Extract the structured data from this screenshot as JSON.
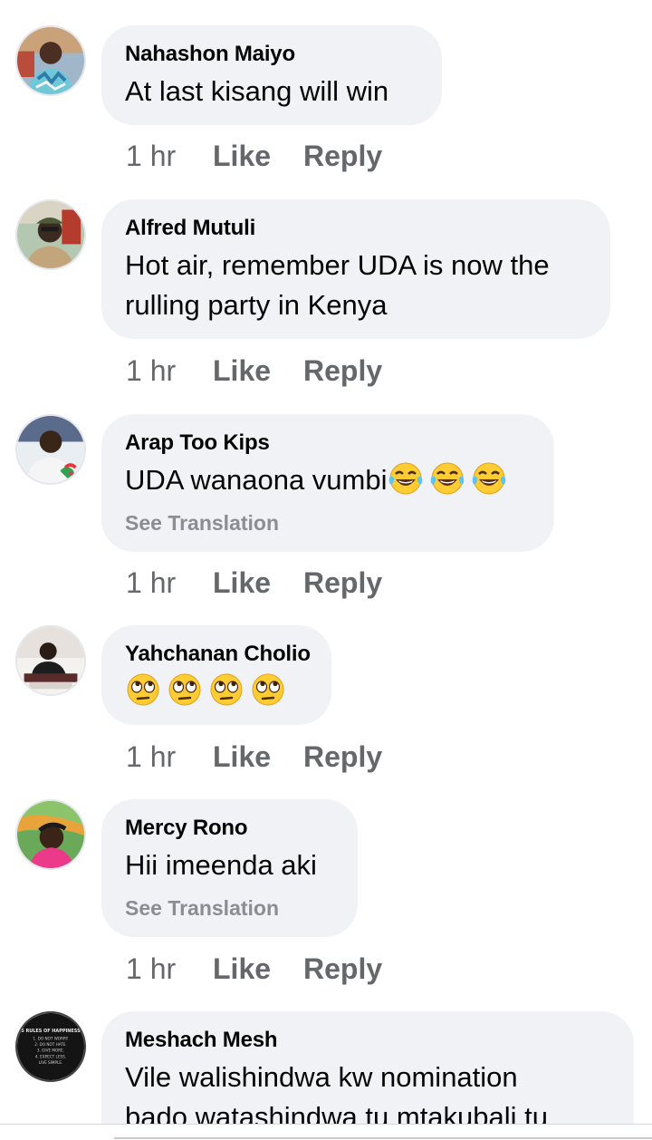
{
  "comments": [
    {
      "author": "Nahashon Maiyo",
      "text": "At last kisang will win",
      "time": "1 hr",
      "like": "Like",
      "reply": "Reply"
    },
    {
      "author": "Alfred Mutuli",
      "text_lines": [
        "Hot air, remember UDA is now the",
        "rulling party in Kenya"
      ],
      "time": "1 hr",
      "like": "Like",
      "reply": "Reply"
    },
    {
      "author": "Arap Too Kips",
      "text": "UDA wanaona vumbi",
      "emojis": [
        "face-with-tears-of-joy-icon",
        "face-with-tears-of-joy-icon",
        "face-with-tears-of-joy-icon"
      ],
      "see_translation": "See Translation",
      "time": "1 hr",
      "like": "Like",
      "reply": "Reply"
    },
    {
      "author": "Yahchanan Cholio",
      "emojis": [
        "face-with-rolling-eyes-icon",
        "face-with-rolling-eyes-icon",
        "face-with-rolling-eyes-icon",
        "face-with-rolling-eyes-icon"
      ],
      "time": "1 hr",
      "like": "Like",
      "reply": "Reply"
    },
    {
      "author": "Mercy Rono",
      "text": "Hii imeenda aki",
      "see_translation": "See Translation",
      "time": "1 hr",
      "like": "Like",
      "reply": "Reply"
    },
    {
      "author": "Meshach Mesh",
      "text_lines": [
        "Vile walishindwa kw nomination",
        "bado watashindwa tu   mtakubali tu"
      ]
    }
  ],
  "avatar_badge_text": [
    "5 RULES OF HAPPINESS",
    "1. DO NOT WORRY.",
    "2. DO NOT HATE.",
    "3. GIVE MORE.",
    "4. EXPECT LESS.",
    "LIVE SIMPLE."
  ],
  "colors": {
    "bubble": "#f0f2f5",
    "author": "#050505",
    "meta": "#65676b",
    "translation": "#8a8d91"
  }
}
